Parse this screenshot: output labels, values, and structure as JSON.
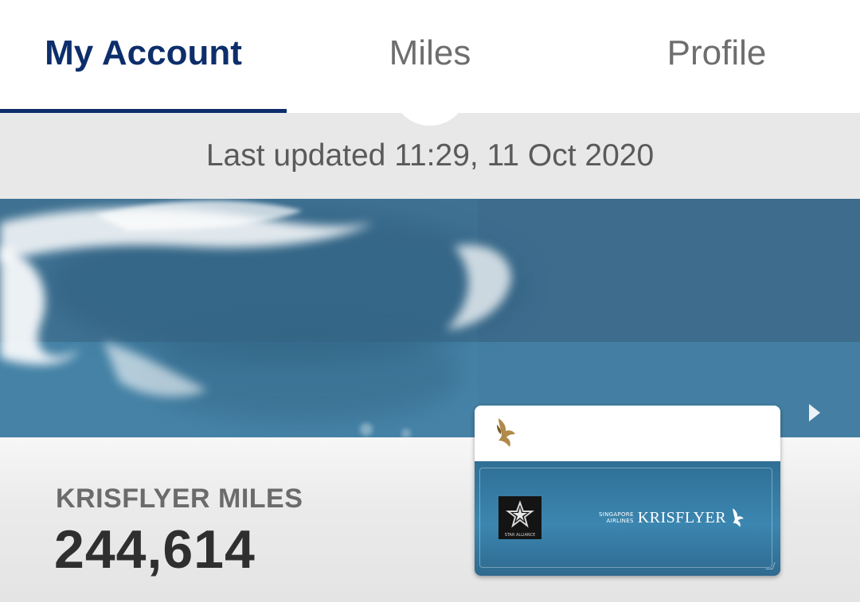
{
  "tabs": [
    {
      "label": "My Account",
      "active": true
    },
    {
      "label": "Miles",
      "active": false
    },
    {
      "label": "Profile",
      "active": false
    }
  ],
  "status": {
    "last_updated": "Last updated 11:29, 11 Oct 2020"
  },
  "account": {
    "miles_label": "KRISFLYER MILES",
    "miles_value": "244,614"
  },
  "card": {
    "airline_small": "SINGAPORE\nAIRLINES",
    "program_name": "KRISFLYER",
    "alliance_text": "STAR ALLIANCE",
    "top_logo_icon": "singapore-airlines-bird-icon",
    "alliance_icon": "star-alliance-logo-icon"
  },
  "colors": {
    "brand_navy": "#0d2e6b",
    "hero_blue": "#3e7699",
    "card_blue": "#3b86b0",
    "gold": "#b08a48"
  }
}
